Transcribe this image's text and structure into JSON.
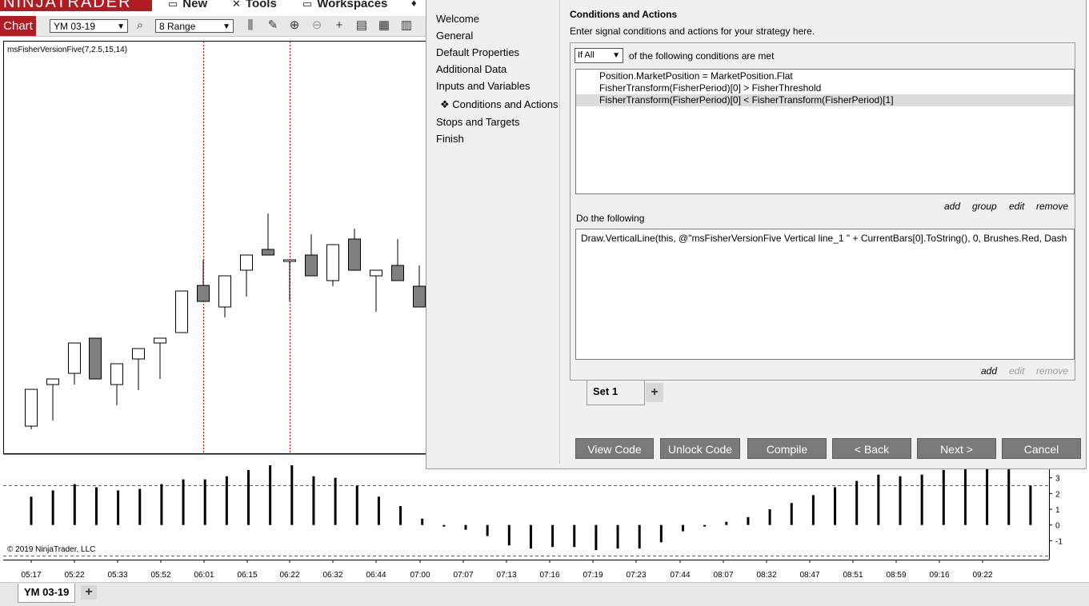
{
  "app": {
    "logo": "NINJATRADER",
    "menu": [
      {
        "label": "New",
        "icon": "chart-icon"
      },
      {
        "label": "Tools",
        "icon": "tools-icon"
      },
      {
        "label": "Workspaces",
        "icon": "workspace-icon"
      }
    ]
  },
  "toolbar": {
    "chart_tab": "Chart",
    "instrument": "YM 03-19",
    "interval": "8 Range"
  },
  "chart": {
    "indicator_label": "msFisherVersionFive(7,2.5,15,14)",
    "copyright": "© 2019 NinjaTrader, LLC",
    "bottom_tab": "YM 03-19",
    "colors": {
      "up": "#ffffff",
      "down": "#808080",
      "vline": "#ff0000",
      "threshold": "#8b3fa8"
    }
  },
  "chart_data": {
    "type": "bar",
    "x": [
      "05:17",
      "05:22",
      "05:33",
      "05:52",
      "06:01",
      "06:15",
      "06:22",
      "06:32",
      "06:44",
      "07:00",
      "07:07",
      "07:13",
      "07:16",
      "07:19",
      "07:23",
      "07:44",
      "08:07",
      "08:32",
      "08:47",
      "08:51",
      "08:59",
      "09:16",
      "09:22"
    ],
    "series": [
      {
        "values": [
          1.8,
          2.2,
          2.6,
          2.4,
          2.2,
          2.3,
          2.6,
          2.9,
          2.9,
          3.1,
          3.5,
          3.8,
          3.8,
          3.1,
          3.0,
          2.5,
          1.8,
          1.2,
          0.4,
          0.0,
          -0.3,
          -0.7,
          -1.3,
          -1.5,
          -1.4,
          -1.4,
          -1.6,
          -1.5,
          -1.5,
          -1.1,
          -0.4,
          -0.1,
          0.2,
          0.5,
          1.0,
          1.4,
          1.9,
          2.4,
          2.8,
          3.2,
          3.1,
          3.2,
          3.5,
          3.8,
          3.9,
          3.9,
          2.5
        ]
      }
    ],
    "ylim": [
      -2,
      4
    ],
    "yticks": [
      "3",
      "2",
      "1",
      "0",
      "-1"
    ],
    "threshold": 2.5
  },
  "dialog": {
    "nav": [
      "Welcome",
      "General",
      "Default Properties",
      "Additional Data",
      "Inputs and Variables",
      "Conditions and Actions",
      "Stops and Targets",
      "Finish"
    ],
    "nav_active_marker": "❖",
    "title": "Conditions and Actions",
    "subtitle": "Enter signal conditions and actions for your strategy here.",
    "match_mode": "If All",
    "match_label": "of the following conditions are met",
    "conditions": [
      "Position.MarketPosition = MarketPosition.Flat",
      "FisherTransform(FisherPeriod)[0] > FisherThreshold",
      "FisherTransform(FisherPeriod)[0] < FisherTransform(FisherPeriod)[1]"
    ],
    "cond_links": [
      "add",
      "group",
      "edit",
      "remove"
    ],
    "do_label": "Do the following",
    "actions": [
      "Draw.VerticalLine(this, @\"msFisherVersionFive Vertical line_1 \" + CurrentBars[0].ToString(), 0, Brushes.Red, Dash"
    ],
    "act_links": [
      "add",
      "edit",
      "remove"
    ],
    "set_tab": "Set 1",
    "set_plus": "+",
    "buttons": [
      "View Code",
      "Unlock Code",
      "Compile",
      "< Back",
      "Next >",
      "Cancel"
    ]
  }
}
